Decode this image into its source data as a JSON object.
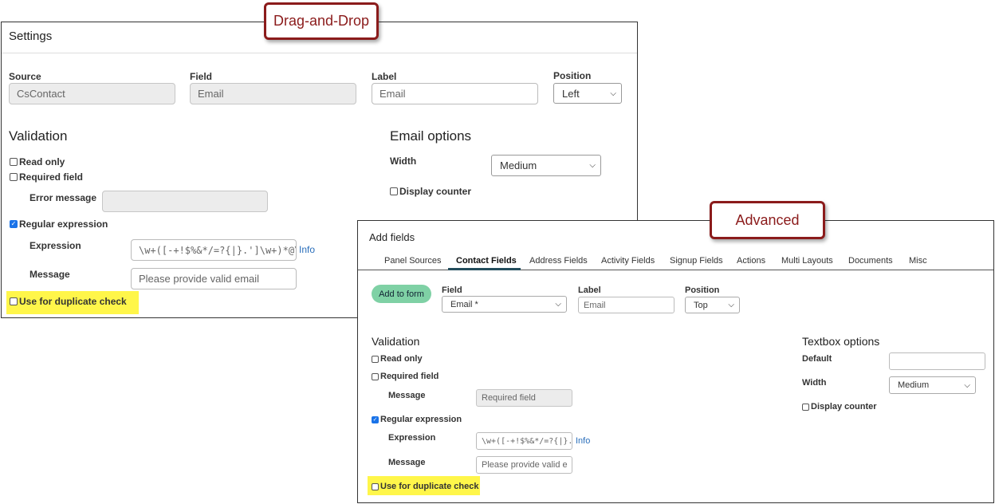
{
  "callouts": {
    "top": "Drag-and-Drop",
    "bottom": "Advanced"
  },
  "dnd": {
    "title": "Settings",
    "source_label": "Source",
    "source_value": "CsContact",
    "field_label": "Field",
    "field_value": "Email",
    "label_label": "Label",
    "label_value": "Email",
    "position_label": "Position",
    "position_value": "Left",
    "validation_title": "Validation",
    "read_only": "Read only",
    "required_field": "Required field",
    "error_message_label": "Error message",
    "error_message_value": "",
    "regex_label": "Regular expression",
    "expression_label": "Expression",
    "expression_value": "\\w+([-+!$%&*/=?{|}.']\\w+)*@\\w",
    "info_link": "Info",
    "message_label": "Message",
    "message_placeholder": "Please provide valid email",
    "duplicate_check": "Use for duplicate check",
    "email_options_title": "Email options",
    "width_label": "Width",
    "width_value": "Medium",
    "display_counter": "Display counter",
    "checks": {
      "read_only": false,
      "required_field": false,
      "regex": true,
      "duplicate": false,
      "display_counter": false
    }
  },
  "adv": {
    "title": "Add fields",
    "tabs": [
      "Panel Sources",
      "Contact Fields",
      "Address Fields",
      "Activity Fields",
      "Signup Fields",
      "Actions",
      "Multi Layouts",
      "Documents",
      "Misc"
    ],
    "active_tab": "Contact Fields",
    "add_button": "Add to form",
    "field_label": "Field",
    "field_value": "Email *",
    "label_label": "Label",
    "label_value": "Email",
    "position_label": "Position",
    "position_value": "Top",
    "validation_title": "Validation",
    "read_only": "Read only",
    "required_field": "Required field",
    "message_label_1": "Message",
    "message_value_1": "Required field",
    "regex_label": "Regular expression",
    "expression_label": "Expression",
    "expression_value": "\\w+([-+!$%&*/=?{|}.']",
    "info_link": "Info",
    "message_label_2": "Message",
    "message_placeholder_2": "Please provide valid e",
    "duplicate_check": "Use for duplicate check",
    "textbox_options_title": "Textbox options",
    "default_label": "Default",
    "default_value": "",
    "width_label": "Width",
    "width_value": "Medium",
    "display_counter": "Display counter",
    "checks": {
      "read_only": false,
      "required_field": false,
      "regex": true,
      "duplicate": false,
      "display_counter": false
    }
  },
  "colors": {
    "callout_border": "#8b1b1b",
    "highlight": "#fff64a",
    "add_button": "#7fd1a5",
    "active_tab_underline": "#234d5c",
    "link": "#2a6ebb"
  }
}
